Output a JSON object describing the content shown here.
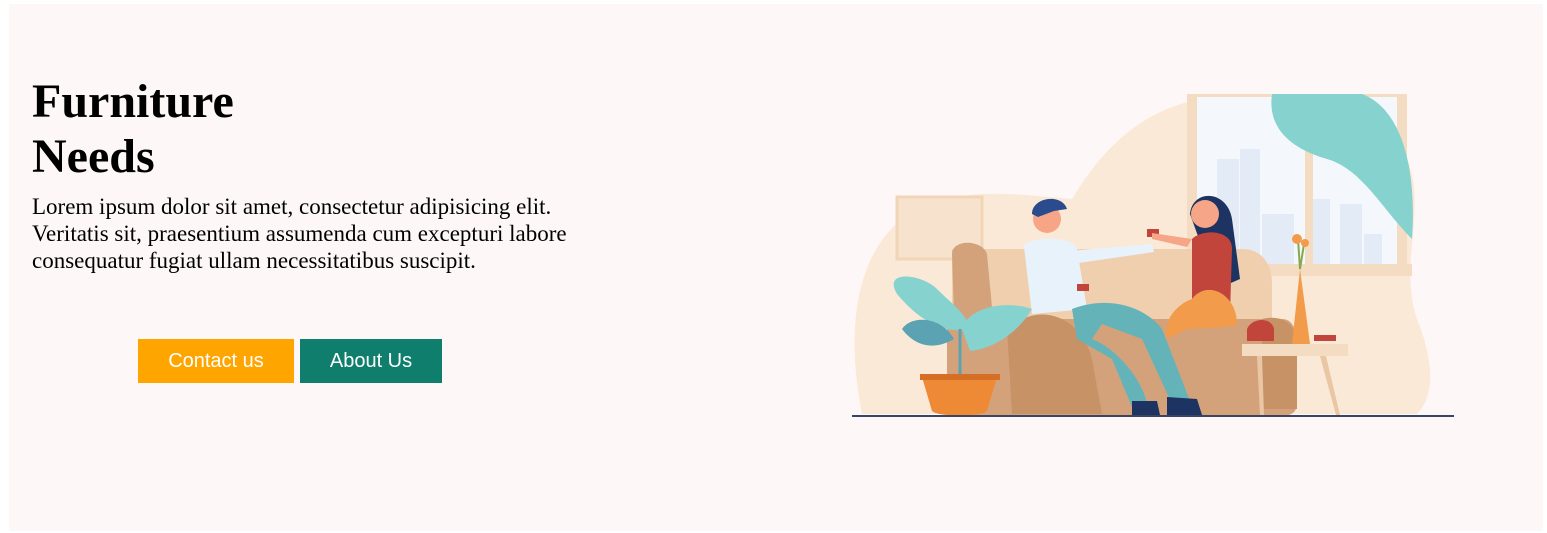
{
  "hero": {
    "title_line1": "Furniture",
    "title_line2": "Needs",
    "description_lines": [
      "Lorem ipsum dolor sit amet, consectetur adipisicing elit.",
      "Veritatis sit, praesentium assumenda cum excepturi labore",
      "consequatur fugiat ullam necessitatibus suscipit."
    ],
    "contact_label": "Contact us",
    "about_label": "About Us"
  },
  "colors": {
    "background": "#fdf8f7",
    "contact_button": "#ffa500",
    "about_button": "#0f7e6d",
    "accent_teal": "#86d2cf",
    "sofa": "#d4a27a"
  },
  "illustration": {
    "icon": "couple-on-sofa-illustration"
  }
}
